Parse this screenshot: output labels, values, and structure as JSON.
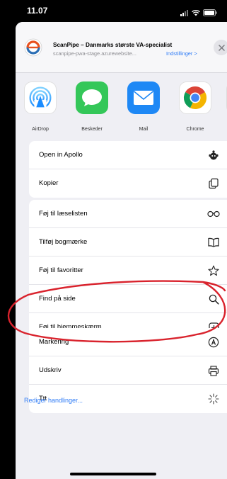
{
  "status_bar": {
    "time": "11.07"
  },
  "header": {
    "title": "ScanPipe – Danmarks største VA-specialist",
    "url": "scanpipe-pwa-stage.azurewebsite...",
    "settings_label": "Indstillinger >"
  },
  "apps": [
    {
      "label": "AirDrop",
      "icon": "airdrop-icon"
    },
    {
      "label": "Beskeder",
      "icon": "messages-icon"
    },
    {
      "label": "Mail",
      "icon": "mail-icon"
    },
    {
      "label": "Chrome",
      "icon": "chrome-icon"
    }
  ],
  "groups": [
    {
      "items": [
        {
          "label": "Open in Apollo",
          "icon": "apollo-icon"
        },
        {
          "label": "Kopier",
          "icon": "copy-icon"
        }
      ]
    },
    {
      "items": [
        {
          "label": "Føj til læselisten",
          "icon": "glasses-icon"
        },
        {
          "label": "Tilføj bogmærke",
          "icon": "book-icon"
        },
        {
          "label": "Føj til favoritter",
          "icon": "star-icon"
        },
        {
          "label": "Find på side",
          "icon": "search-icon"
        },
        {
          "label": "Føj til hjemmeskærm",
          "icon": "add-square-icon"
        }
      ]
    },
    {
      "items": [
        {
          "label": "Markering",
          "icon": "markup-icon"
        },
        {
          "label": "Udskriv",
          "icon": "printer-icon"
        },
        {
          "label": "Ttt",
          "icon": "sparkle-icon"
        }
      ]
    }
  ],
  "footer": {
    "edit_actions": "Rediger handlinger..."
  },
  "colors": {
    "accent": "#2f7cf6",
    "annotation": "#d9232d",
    "messages": "#34c759",
    "mail": "#1e88f5"
  }
}
